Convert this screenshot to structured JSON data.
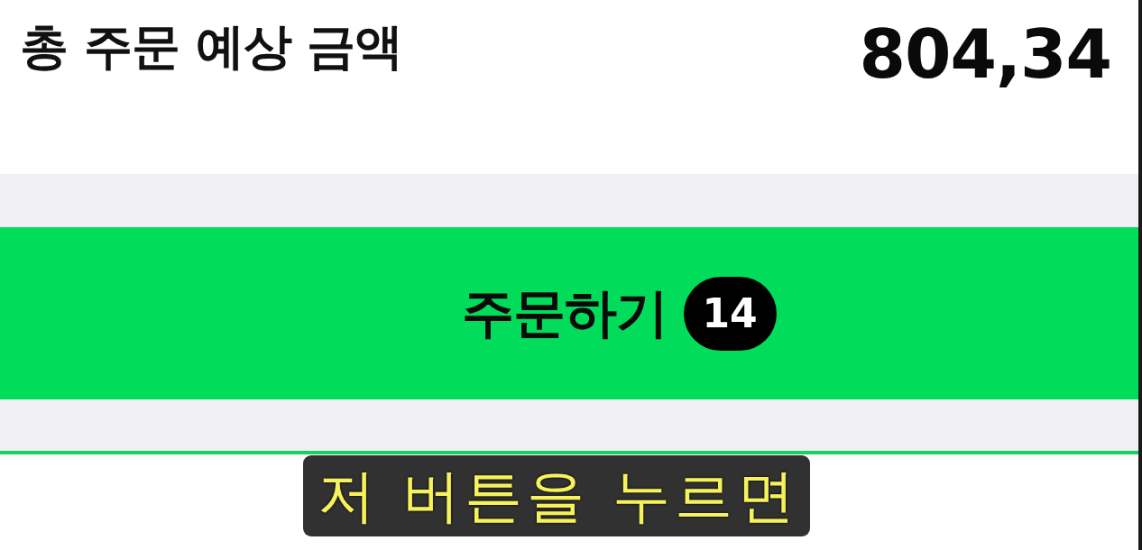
{
  "summary": {
    "label": "총 주문 예상 금액",
    "amount": "804,34"
  },
  "order_button": {
    "label": "주문하기",
    "count": "14"
  },
  "subtitle": {
    "text": "저 버튼을 누르면"
  }
}
